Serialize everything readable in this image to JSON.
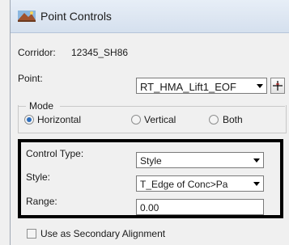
{
  "window": {
    "title": "Point Controls"
  },
  "corridor": {
    "label": "Corridor:",
    "value": "12345_SH86"
  },
  "point": {
    "label": "Point:",
    "value": "RT_HMA_Lift1_EOF"
  },
  "mode": {
    "label": "Mode",
    "options": [
      {
        "label": "Horizontal",
        "checked": true
      },
      {
        "label": "Vertical",
        "checked": false
      },
      {
        "label": "Both",
        "checked": false
      }
    ]
  },
  "control_type": {
    "label": "Control Type:",
    "value": "Style"
  },
  "style": {
    "label": "Style:",
    "value": "T_Edge of Conc>Pa"
  },
  "range": {
    "label": "Range:",
    "value": "0.00"
  },
  "secondary": {
    "label": "Use as Secondary Alignment",
    "checked": false
  },
  "icons": {
    "window": "corridor-app-icon",
    "pick": "crosshair-icon"
  }
}
